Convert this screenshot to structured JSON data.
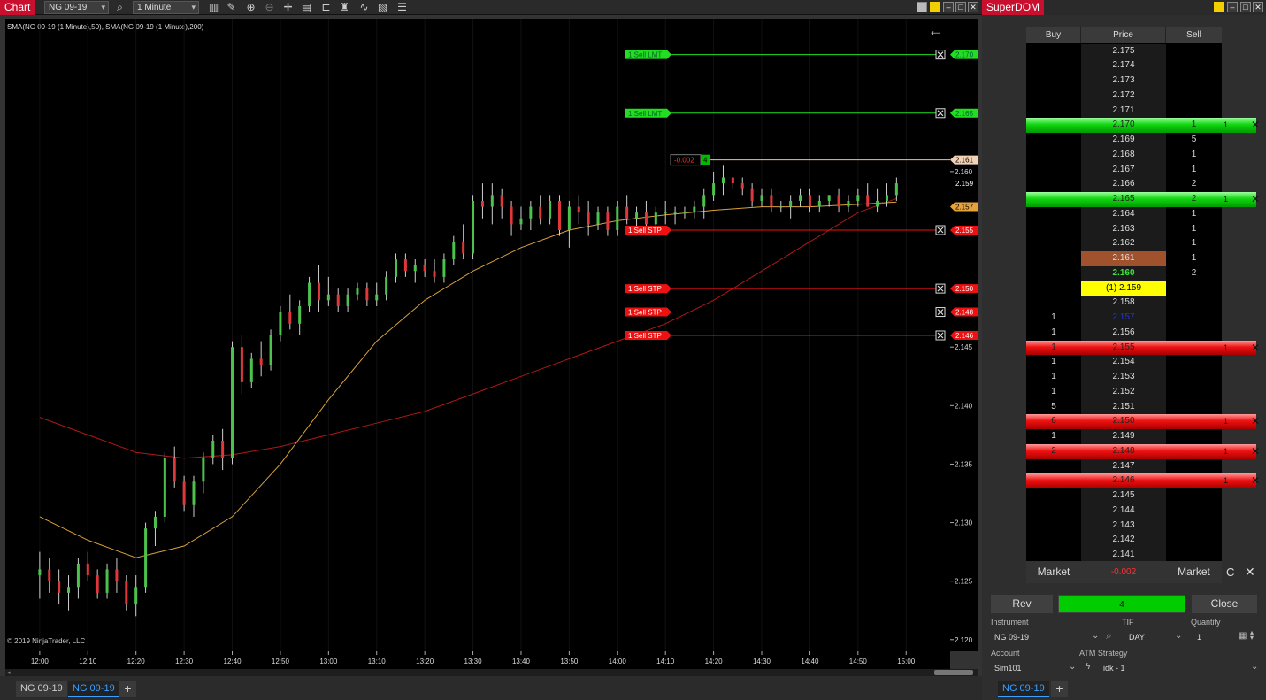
{
  "chart_window": {
    "title": "Chart",
    "instrument": "NG 09-19",
    "interval": "1 Minute",
    "indicator_label": "SMA(NG 09-19 (1 Minute),50), SMA(NG 09-19 (1 Minute),200)",
    "copyright": "© 2019 NinjaTrader, LLC",
    "tabs": [
      "NG 09-19",
      "NG 09-19"
    ],
    "add_tab": "+",
    "toolbar_icons": [
      "search-icon",
      "bar-type-icon",
      "draw-icon",
      "zoom-in-icon",
      "zoom-out-icon",
      "crosshair-icon",
      "properties-icon",
      "templates-icon",
      "strategies-icon",
      "indicators-icon",
      "data-box-icon"
    ],
    "back_arrow": "←"
  },
  "chart_data": {
    "type": "candlestick",
    "title": "",
    "y_ticks": [
      "2.160",
      "2.145",
      "2.140",
      "2.135",
      "2.130",
      "2.125",
      "2.120"
    ],
    "x_ticks": [
      "12:00",
      "12:10",
      "12:20",
      "12:30",
      "12:40",
      "12:50",
      "13:00",
      "13:10",
      "13:20",
      "13:30",
      "13:40",
      "13:50",
      "14:00",
      "14:10",
      "14:20",
      "14:30",
      "14:40",
      "14:50",
      "15:00"
    ],
    "ylim": [
      2.119,
      2.173
    ],
    "x_range_minutes": [
      718,
      904
    ],
    "candles": [
      {
        "t": 720,
        "o": 2.1255,
        "h": 2.1275,
        "l": 2.1235,
        "c": 2.126
      },
      {
        "t": 722,
        "o": 2.126,
        "h": 2.127,
        "l": 2.124,
        "c": 2.125
      },
      {
        "t": 724,
        "o": 2.125,
        "h": 2.126,
        "l": 2.123,
        "c": 2.124
      },
      {
        "t": 726,
        "o": 2.124,
        "h": 2.1255,
        "l": 2.1225,
        "c": 2.1245
      },
      {
        "t": 728,
        "o": 2.1245,
        "h": 2.127,
        "l": 2.1235,
        "c": 2.1265
      },
      {
        "t": 730,
        "o": 2.1265,
        "h": 2.1275,
        "l": 2.125,
        "c": 2.1255
      },
      {
        "t": 732,
        "o": 2.1255,
        "h": 2.126,
        "l": 2.1235,
        "c": 2.124
      },
      {
        "t": 734,
        "o": 2.124,
        "h": 2.1265,
        "l": 2.1235,
        "c": 2.126
      },
      {
        "t": 736,
        "o": 2.126,
        "h": 2.127,
        "l": 2.124,
        "c": 2.125
      },
      {
        "t": 738,
        "o": 2.125,
        "h": 2.1255,
        "l": 2.1225,
        "c": 2.123
      },
      {
        "t": 740,
        "o": 2.123,
        "h": 2.1255,
        "l": 2.122,
        "c": 2.1245
      },
      {
        "t": 742,
        "o": 2.1245,
        "h": 2.13,
        "l": 2.124,
        "c": 2.1295
      },
      {
        "t": 744,
        "o": 2.1295,
        "h": 2.131,
        "l": 2.128,
        "c": 2.1305
      },
      {
        "t": 746,
        "o": 2.1305,
        "h": 2.136,
        "l": 2.13,
        "c": 2.1355
      },
      {
        "t": 748,
        "o": 2.1355,
        "h": 2.1365,
        "l": 2.133,
        "c": 2.1335
      },
      {
        "t": 750,
        "o": 2.1335,
        "h": 2.134,
        "l": 2.131,
        "c": 2.1315
      },
      {
        "t": 752,
        "o": 2.1315,
        "h": 2.134,
        "l": 2.1305,
        "c": 2.1335
      },
      {
        "t": 754,
        "o": 2.1335,
        "h": 2.136,
        "l": 2.1325,
        "c": 2.1355
      },
      {
        "t": 756,
        "o": 2.1355,
        "h": 2.1375,
        "l": 2.135,
        "c": 2.137
      },
      {
        "t": 758,
        "o": 2.137,
        "h": 2.138,
        "l": 2.1345,
        "c": 2.1355
      },
      {
        "t": 760,
        "o": 2.1355,
        "h": 2.1455,
        "l": 2.135,
        "c": 2.145
      },
      {
        "t": 762,
        "o": 2.145,
        "h": 2.146,
        "l": 2.141,
        "c": 2.142
      },
      {
        "t": 764,
        "o": 2.142,
        "h": 2.1445,
        "l": 2.1415,
        "c": 2.144
      },
      {
        "t": 766,
        "o": 2.144,
        "h": 2.1455,
        "l": 2.1425,
        "c": 2.1435
      },
      {
        "t": 768,
        "o": 2.1435,
        "h": 2.1465,
        "l": 2.143,
        "c": 2.146
      },
      {
        "t": 770,
        "o": 2.146,
        "h": 2.1485,
        "l": 2.1455,
        "c": 2.148
      },
      {
        "t": 772,
        "o": 2.148,
        "h": 2.1495,
        "l": 2.1465,
        "c": 2.147
      },
      {
        "t": 774,
        "o": 2.147,
        "h": 2.149,
        "l": 2.146,
        "c": 2.1485
      },
      {
        "t": 776,
        "o": 2.1485,
        "h": 2.151,
        "l": 2.148,
        "c": 2.1505
      },
      {
        "t": 778,
        "o": 2.1505,
        "h": 2.152,
        "l": 2.148,
        "c": 2.149
      },
      {
        "t": 780,
        "o": 2.149,
        "h": 2.151,
        "l": 2.1485,
        "c": 2.1495
      },
      {
        "t": 782,
        "o": 2.1495,
        "h": 2.15,
        "l": 2.148,
        "c": 2.1485
      },
      {
        "t": 784,
        "o": 2.1485,
        "h": 2.15,
        "l": 2.148,
        "c": 2.1495
      },
      {
        "t": 786,
        "o": 2.1495,
        "h": 2.1505,
        "l": 2.149,
        "c": 2.15
      },
      {
        "t": 788,
        "o": 2.15,
        "h": 2.1505,
        "l": 2.1485,
        "c": 2.149
      },
      {
        "t": 790,
        "o": 2.149,
        "h": 2.1505,
        "l": 2.1485,
        "c": 2.1495
      },
      {
        "t": 792,
        "o": 2.1495,
        "h": 2.1515,
        "l": 2.149,
        "c": 2.151
      },
      {
        "t": 794,
        "o": 2.151,
        "h": 2.153,
        "l": 2.1505,
        "c": 2.1525
      },
      {
        "t": 796,
        "o": 2.1525,
        "h": 2.153,
        "l": 2.151,
        "c": 2.1515
      },
      {
        "t": 798,
        "o": 2.1515,
        "h": 2.1525,
        "l": 2.1505,
        "c": 2.152
      },
      {
        "t": 800,
        "o": 2.152,
        "h": 2.1525,
        "l": 2.151,
        "c": 2.1515
      },
      {
        "t": 802,
        "o": 2.1515,
        "h": 2.1525,
        "l": 2.1505,
        "c": 2.151
      },
      {
        "t": 804,
        "o": 2.151,
        "h": 2.153,
        "l": 2.1505,
        "c": 2.1525
      },
      {
        "t": 806,
        "o": 2.1525,
        "h": 2.1545,
        "l": 2.152,
        "c": 2.154
      },
      {
        "t": 808,
        "o": 2.154,
        "h": 2.1555,
        "l": 2.1525,
        "c": 2.153
      },
      {
        "t": 810,
        "o": 2.153,
        "h": 2.158,
        "l": 2.1525,
        "c": 2.1575
      },
      {
        "t": 812,
        "o": 2.1575,
        "h": 2.159,
        "l": 2.156,
        "c": 2.157
      },
      {
        "t": 814,
        "o": 2.157,
        "h": 2.159,
        "l": 2.1555,
        "c": 2.158
      },
      {
        "t": 816,
        "o": 2.158,
        "h": 2.1585,
        "l": 2.156,
        "c": 2.157
      },
      {
        "t": 818,
        "o": 2.157,
        "h": 2.1575,
        "l": 2.1545,
        "c": 2.1555
      },
      {
        "t": 820,
        "o": 2.1555,
        "h": 2.157,
        "l": 2.155,
        "c": 2.156
      },
      {
        "t": 822,
        "o": 2.156,
        "h": 2.1575,
        "l": 2.155,
        "c": 2.157
      },
      {
        "t": 824,
        "o": 2.157,
        "h": 2.158,
        "l": 2.1555,
        "c": 2.156
      },
      {
        "t": 826,
        "o": 2.156,
        "h": 2.158,
        "l": 2.1555,
        "c": 2.1575
      },
      {
        "t": 828,
        "o": 2.1575,
        "h": 2.158,
        "l": 2.1545,
        "c": 2.155
      },
      {
        "t": 830,
        "o": 2.155,
        "h": 2.1575,
        "l": 2.1535,
        "c": 2.157
      },
      {
        "t": 832,
        "o": 2.157,
        "h": 2.158,
        "l": 2.1555,
        "c": 2.1565
      },
      {
        "t": 834,
        "o": 2.1565,
        "h": 2.1575,
        "l": 2.1545,
        "c": 2.1555
      },
      {
        "t": 836,
        "o": 2.1555,
        "h": 2.157,
        "l": 2.155,
        "c": 2.1565
      },
      {
        "t": 838,
        "o": 2.1565,
        "h": 2.157,
        "l": 2.1545,
        "c": 2.155
      },
      {
        "t": 840,
        "o": 2.155,
        "h": 2.1575,
        "l": 2.1545,
        "c": 2.157
      },
      {
        "t": 842,
        "o": 2.157,
        "h": 2.158,
        "l": 2.1555,
        "c": 2.156
      },
      {
        "t": 844,
        "o": 2.156,
        "h": 2.157,
        "l": 2.155,
        "c": 2.1565
      },
      {
        "t": 846,
        "o": 2.1565,
        "h": 2.1575,
        "l": 2.155,
        "c": 2.1555
      },
      {
        "t": 848,
        "o": 2.1555,
        "h": 2.157,
        "l": 2.155,
        "c": 2.1565
      },
      {
        "t": 850,
        "o": 2.1565,
        "h": 2.1575,
        "l": 2.1555,
        "c": 2.1565
      },
      {
        "t": 852,
        "o": 2.1565,
        "h": 2.157,
        "l": 2.1555,
        "c": 2.1565
      },
      {
        "t": 854,
        "o": 2.1565,
        "h": 2.157,
        "l": 2.156,
        "c": 2.1565
      },
      {
        "t": 856,
        "o": 2.1565,
        "h": 2.1575,
        "l": 2.156,
        "c": 2.157
      },
      {
        "t": 858,
        "o": 2.157,
        "h": 2.1585,
        "l": 2.156,
        "c": 2.158
      },
      {
        "t": 860,
        "o": 2.158,
        "h": 2.16,
        "l": 2.1575,
        "c": 2.159
      },
      {
        "t": 862,
        "o": 2.159,
        "h": 2.1605,
        "l": 2.158,
        "c": 2.1595
      },
      {
        "t": 864,
        "o": 2.1595,
        "h": 2.1595,
        "l": 2.1585,
        "c": 2.159
      },
      {
        "t": 866,
        "o": 2.159,
        "h": 2.1595,
        "l": 2.158,
        "c": 2.1585
      },
      {
        "t": 868,
        "o": 2.1585,
        "h": 2.159,
        "l": 2.157,
        "c": 2.1575
      },
      {
        "t": 870,
        "o": 2.1575,
        "h": 2.1585,
        "l": 2.157,
        "c": 2.158
      },
      {
        "t": 872,
        "o": 2.158,
        "h": 2.1585,
        "l": 2.1565,
        "c": 2.157
      },
      {
        "t": 874,
        "o": 2.157,
        "h": 2.1575,
        "l": 2.1565,
        "c": 2.157
      },
      {
        "t": 876,
        "o": 2.157,
        "h": 2.158,
        "l": 2.156,
        "c": 2.1575
      },
      {
        "t": 878,
        "o": 2.1575,
        "h": 2.1585,
        "l": 2.157,
        "c": 2.158
      },
      {
        "t": 880,
        "o": 2.158,
        "h": 2.1585,
        "l": 2.1565,
        "c": 2.157
      },
      {
        "t": 882,
        "o": 2.157,
        "h": 2.158,
        "l": 2.1565,
        "c": 2.1575
      },
      {
        "t": 884,
        "o": 2.1575,
        "h": 2.158,
        "l": 2.157,
        "c": 2.158
      },
      {
        "t": 886,
        "o": 2.158,
        "h": 2.1585,
        "l": 2.1565,
        "c": 2.157
      },
      {
        "t": 888,
        "o": 2.157,
        "h": 2.158,
        "l": 2.1565,
        "c": 2.1575
      },
      {
        "t": 890,
        "o": 2.1575,
        "h": 2.1585,
        "l": 2.157,
        "c": 2.158
      },
      {
        "t": 892,
        "o": 2.158,
        "h": 2.159,
        "l": 2.157,
        "c": 2.157
      },
      {
        "t": 894,
        "o": 2.157,
        "h": 2.1585,
        "l": 2.1565,
        "c": 2.1575
      },
      {
        "t": 896,
        "o": 2.1575,
        "h": 2.159,
        "l": 2.157,
        "c": 2.158
      },
      {
        "t": 898,
        "o": 2.158,
        "h": 2.1595,
        "l": 2.1575,
        "c": 2.159
      }
    ],
    "sma50": [
      [
        720,
        2.1305
      ],
      [
        730,
        2.1285
      ],
      [
        740,
        2.127
      ],
      [
        750,
        2.128
      ],
      [
        760,
        2.1305
      ],
      [
        770,
        2.135
      ],
      [
        780,
        2.1405
      ],
      [
        790,
        2.1455
      ],
      [
        800,
        2.149
      ],
      [
        810,
        2.1515
      ],
      [
        820,
        2.1535
      ],
      [
        830,
        2.155
      ],
      [
        840,
        2.1558
      ],
      [
        850,
        2.1563
      ],
      [
        860,
        2.1567
      ],
      [
        870,
        2.157
      ],
      [
        880,
        2.157
      ],
      [
        890,
        2.1572
      ],
      [
        898,
        2.1574
      ]
    ],
    "sma200": [
      [
        720,
        2.139
      ],
      [
        730,
        2.1375
      ],
      [
        740,
        2.136
      ],
      [
        750,
        2.1355
      ],
      [
        760,
        2.1358
      ],
      [
        770,
        2.1365
      ],
      [
        780,
        2.1375
      ],
      [
        790,
        2.1385
      ],
      [
        800,
        2.1395
      ],
      [
        810,
        2.141
      ],
      [
        820,
        2.1425
      ],
      [
        830,
        2.144
      ],
      [
        840,
        2.1455
      ],
      [
        850,
        2.147
      ],
      [
        860,
        2.149
      ],
      [
        870,
        2.1515
      ],
      [
        880,
        2.154
      ],
      [
        890,
        2.1565
      ],
      [
        898,
        2.1577
      ]
    ],
    "colors": {
      "up": "#4cc24c",
      "down": "#e0373b",
      "sma50": "#d8a23a",
      "sma200": "#b01818",
      "grid": "#111111"
    },
    "orders": [
      {
        "label": "1  Sell LMT",
        "price": "2.170",
        "y": 2.17,
        "kind": "limit"
      },
      {
        "label": "1  Sell LMT",
        "price": "2.165",
        "y": 2.165,
        "kind": "limit"
      },
      {
        "label": "1  Sell STP",
        "price": "2.155",
        "y": 2.155,
        "kind": "stop"
      },
      {
        "label": "1  Sell STP",
        "price": "2.150",
        "y": 2.15,
        "kind": "stop"
      },
      {
        "label": "1  Sell STP",
        "price": "2.148",
        "y": 2.148,
        "kind": "stop"
      },
      {
        "label": "1  Sell STP",
        "price": "2.146",
        "y": 2.146,
        "kind": "stop"
      }
    ],
    "position": {
      "pnl": "-0.002",
      "qty": "4",
      "price": "2.161",
      "y": 2.161
    },
    "price_markers": [
      {
        "text": "2.159",
        "y": 2.159,
        "kind": "last"
      },
      {
        "text": "2.157",
        "y": 2.157,
        "kind": "sma"
      }
    ]
  },
  "superdom": {
    "title": "SuperDOM",
    "headers": {
      "buy": "Buy",
      "price": "Price",
      "sell": "Sell"
    },
    "rows": [
      {
        "price": "2.175",
        "buy": "",
        "sell": "",
        "style": ""
      },
      {
        "price": "2.174",
        "buy": "",
        "sell": "",
        "style": ""
      },
      {
        "price": "2.173",
        "buy": "",
        "sell": "",
        "style": ""
      },
      {
        "price": "2.172",
        "buy": "",
        "sell": "",
        "style": ""
      },
      {
        "price": "2.171",
        "buy": "",
        "sell": "",
        "style": ""
      },
      {
        "price": "2.170",
        "buy": "",
        "sell": "1",
        "style": "green",
        "oq": "1"
      },
      {
        "price": "2.169",
        "buy": "",
        "sell": "5",
        "style": ""
      },
      {
        "price": "2.168",
        "buy": "",
        "sell": "1",
        "style": ""
      },
      {
        "price": "2.167",
        "buy": "",
        "sell": "1",
        "style": ""
      },
      {
        "price": "2.166",
        "buy": "",
        "sell": "2",
        "style": ""
      },
      {
        "price": "2.165",
        "buy": "",
        "sell": "2",
        "style": "green",
        "oq": "1"
      },
      {
        "price": "2.164",
        "buy": "",
        "sell": "1",
        "style": ""
      },
      {
        "price": "2.163",
        "buy": "",
        "sell": "1",
        "style": ""
      },
      {
        "price": "2.162",
        "buy": "",
        "sell": "1",
        "style": ""
      },
      {
        "price": "2.161",
        "buy": "",
        "sell": "1",
        "style": "entry"
      },
      {
        "price": "2.160",
        "buy": "",
        "sell": "2",
        "style": "ask"
      },
      {
        "price": "(1) 2.159",
        "buy": "",
        "sell": "",
        "style": "last"
      },
      {
        "price": "2.158",
        "buy": "",
        "sell": "",
        "style": ""
      },
      {
        "price": "2.157",
        "buy": "1",
        "sell": "",
        "style": "bid"
      },
      {
        "price": "2.156",
        "buy": "1",
        "sell": "",
        "style": ""
      },
      {
        "price": "2.155",
        "buy": "1",
        "sell": "",
        "style": "red",
        "oq": "1"
      },
      {
        "price": "2.154",
        "buy": "1",
        "sell": "",
        "style": ""
      },
      {
        "price": "2.153",
        "buy": "1",
        "sell": "",
        "style": ""
      },
      {
        "price": "2.152",
        "buy": "1",
        "sell": "",
        "style": ""
      },
      {
        "price": "2.151",
        "buy": "5",
        "sell": "",
        "style": ""
      },
      {
        "price": "2.150",
        "buy": "6",
        "sell": "",
        "style": "red",
        "oq": "1"
      },
      {
        "price": "2.149",
        "buy": "1",
        "sell": "",
        "style": ""
      },
      {
        "price": "2.148",
        "buy": "2",
        "sell": "",
        "style": "red",
        "oq": "1"
      },
      {
        "price": "2.147",
        "buy": "",
        "sell": "",
        "style": ""
      },
      {
        "price": "2.146",
        "buy": "",
        "sell": "",
        "style": "red",
        "oq": "1"
      },
      {
        "price": "2.145",
        "buy": "",
        "sell": "",
        "style": ""
      },
      {
        "price": "2.144",
        "buy": "",
        "sell": "",
        "style": ""
      },
      {
        "price": "2.143",
        "buy": "",
        "sell": "",
        "style": ""
      },
      {
        "price": "2.142",
        "buy": "",
        "sell": "",
        "style": ""
      },
      {
        "price": "2.141",
        "buy": "",
        "sell": "",
        "style": ""
      }
    ],
    "footer": {
      "buy_market": "Market",
      "pnl": "-0.002",
      "sell_market": "Market",
      "c": "C",
      "x": "✕"
    },
    "buttons": {
      "rev": "Rev",
      "position": "4",
      "close": "Close"
    },
    "instrument_label": "Instrument",
    "instrument": "NG 09-19",
    "tif_label": "TIF",
    "tif": "DAY",
    "quantity_label": "Quantity",
    "quantity": "1",
    "account_label": "Account",
    "account": "Sim101",
    "atm_label": "ATM Strategy",
    "atm": "idk - 1",
    "tab": "NG 09-19",
    "add_tab": "+"
  }
}
